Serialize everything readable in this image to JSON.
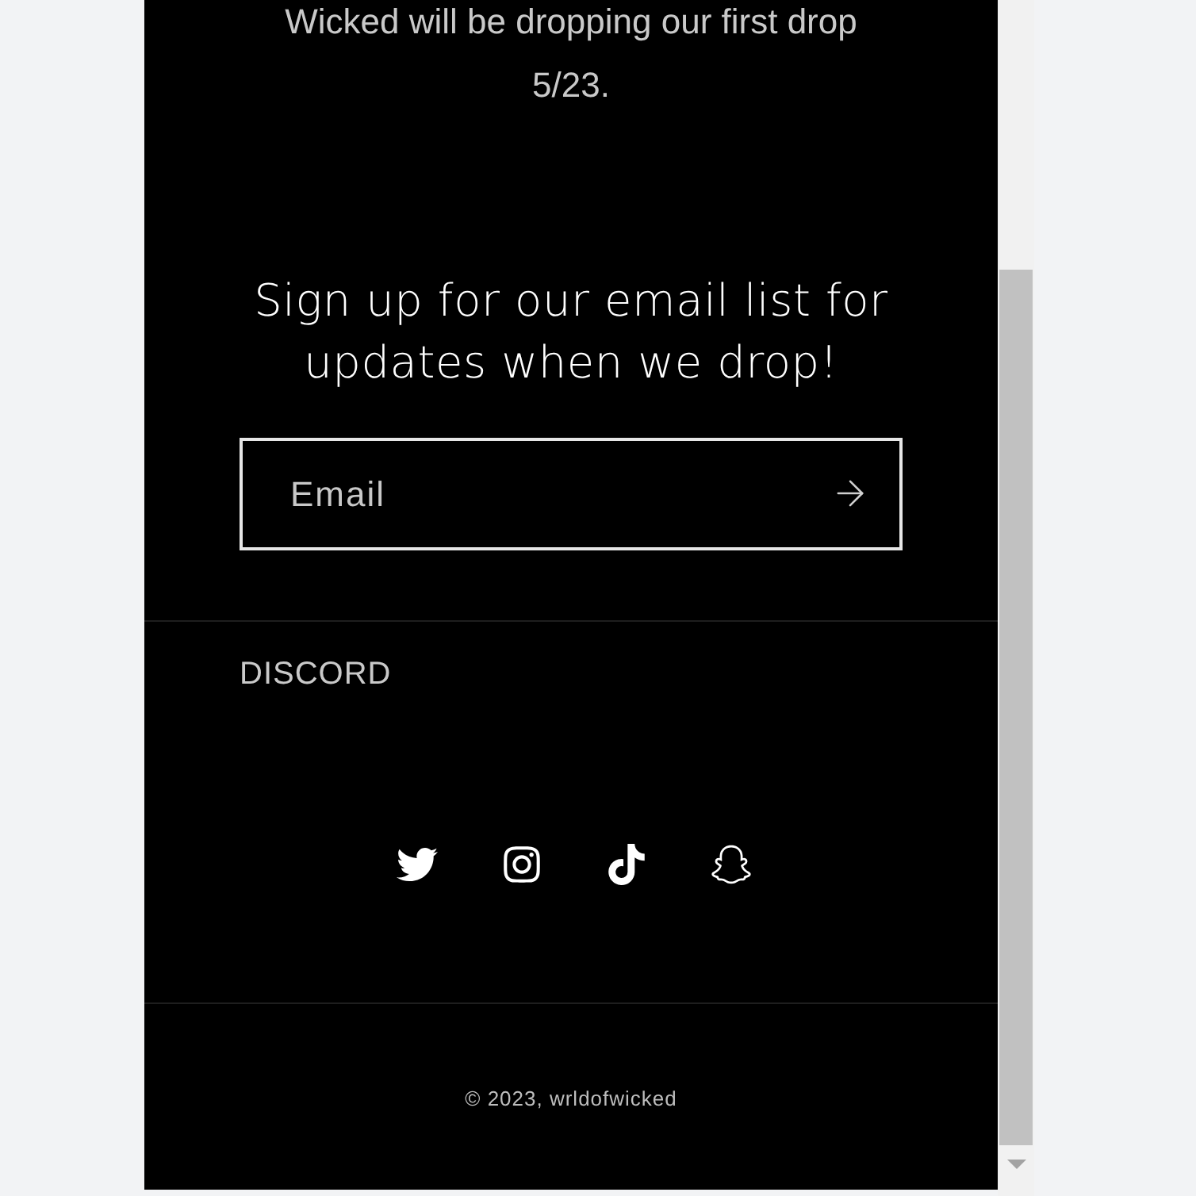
{
  "announcement": "Wicked will be dropping our first drop 5/23.",
  "newsletter": {
    "heading": "Sign up for our email list for updates when we drop!",
    "email": {
      "placeholder": "Email"
    }
  },
  "footer_links": [
    "DISCORD"
  ],
  "social": [
    {
      "kind": "twitter"
    },
    {
      "kind": "instagram"
    },
    {
      "kind": "tiktok"
    },
    {
      "kind": "snapchat"
    }
  ],
  "copyright": "© 2023, wrldofwicked"
}
